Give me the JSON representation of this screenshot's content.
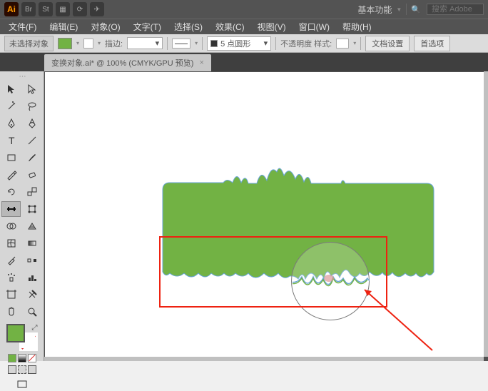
{
  "title": {
    "logo": "Ai",
    "icons": [
      "Br",
      "St",
      "layout",
      "sync",
      "plane"
    ],
    "mode_label": "基本功能",
    "search_placeholder": "搜索 Adobe"
  },
  "menu": {
    "file": "文件(F)",
    "edit": "编辑(E)",
    "object": "对象(O)",
    "type": "文字(T)",
    "select": "选择(S)",
    "effect": "效果(C)",
    "view": "视图(V)",
    "window": "窗口(W)",
    "help": "帮助(H)"
  },
  "control": {
    "noselect": "未选择对象",
    "stroke_label": "描边:",
    "stroke_weight": "",
    "brush_value": "5 点圆形",
    "opacity_label": "不透明度 样式:",
    "doc_setup": "文档设置",
    "preferences": "首选项"
  },
  "tab": {
    "title": "变换对象.ai* @ 100% (CMYK/GPU 预览)"
  },
  "colors": {
    "fill": "#72b244",
    "accent_red": "#e21"
  }
}
